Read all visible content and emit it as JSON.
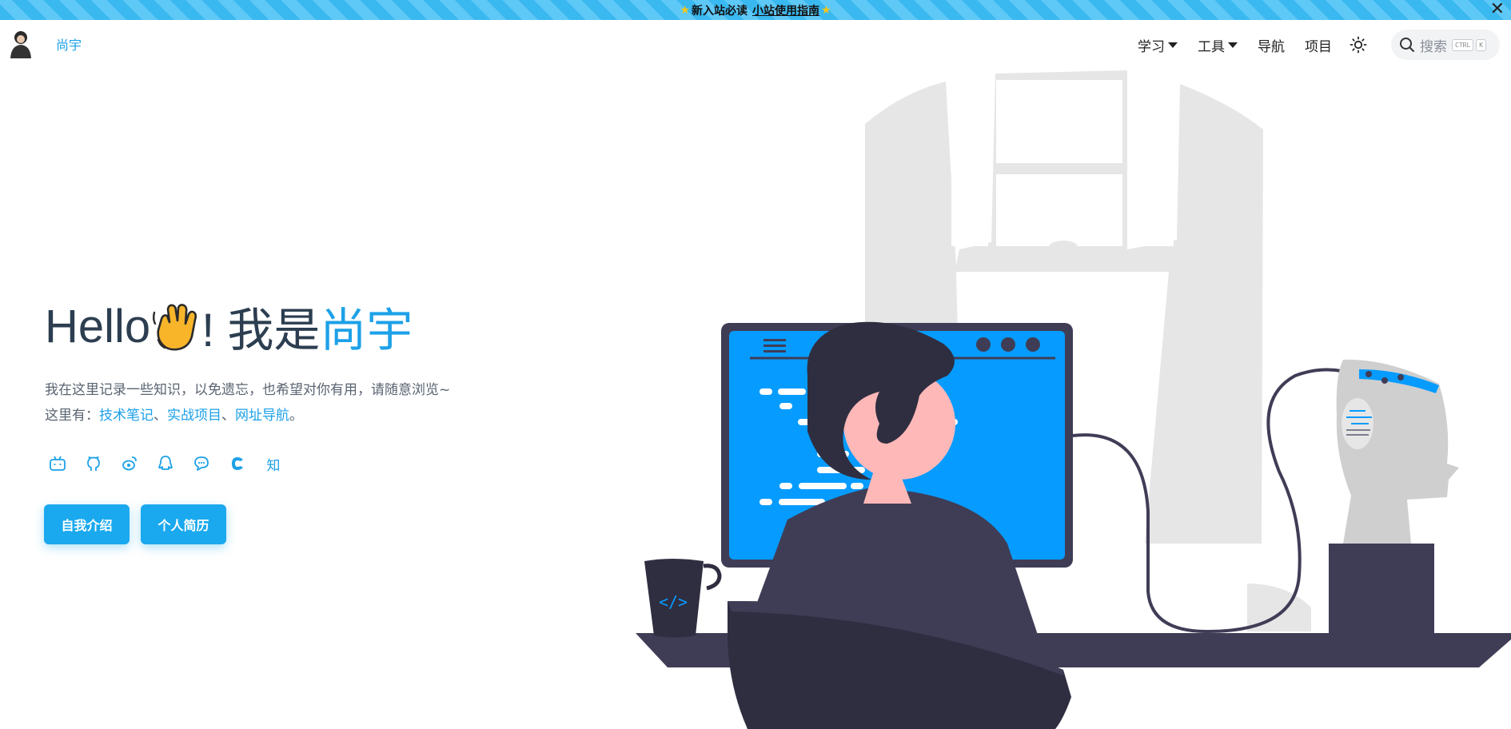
{
  "announcement": {
    "prefix": "新入站必读",
    "link": "小站使用指南",
    "close_icon": "close-icon"
  },
  "brand": {
    "name": "尚宇"
  },
  "nav": {
    "items": [
      {
        "label": "学习",
        "dropdown": true
      },
      {
        "label": "工具",
        "dropdown": true
      },
      {
        "label": "导航",
        "dropdown": false
      },
      {
        "label": "项目",
        "dropdown": false
      }
    ],
    "search": {
      "placeholder": "搜索",
      "keys": [
        "CTRL",
        "K"
      ]
    }
  },
  "hero": {
    "greeting": "Hello",
    "after_emoji": "! 我是",
    "name": "尚宇",
    "line1": "我在这里记录一些知识，以免遗忘，也希望对你有用，请随意浏览~",
    "line2_prefix": "这里有：",
    "links": [
      "技术笔记",
      "实战项目",
      "网址导航"
    ],
    "sep": "、",
    "end": "。"
  },
  "socials": [
    "bilibili-icon",
    "github-icon",
    "weibo-icon",
    "qq-icon",
    "wechat-icon",
    "csdn-icon",
    "zhihu-icon"
  ],
  "zhihu_label": "知",
  "buttons": {
    "intro": "自我介绍",
    "resume": "个人简历"
  },
  "colors": {
    "accent": "#1da1e8",
    "button": "#1aa9ee",
    "dark": "#3f3d56",
    "screen": "#069cff"
  }
}
